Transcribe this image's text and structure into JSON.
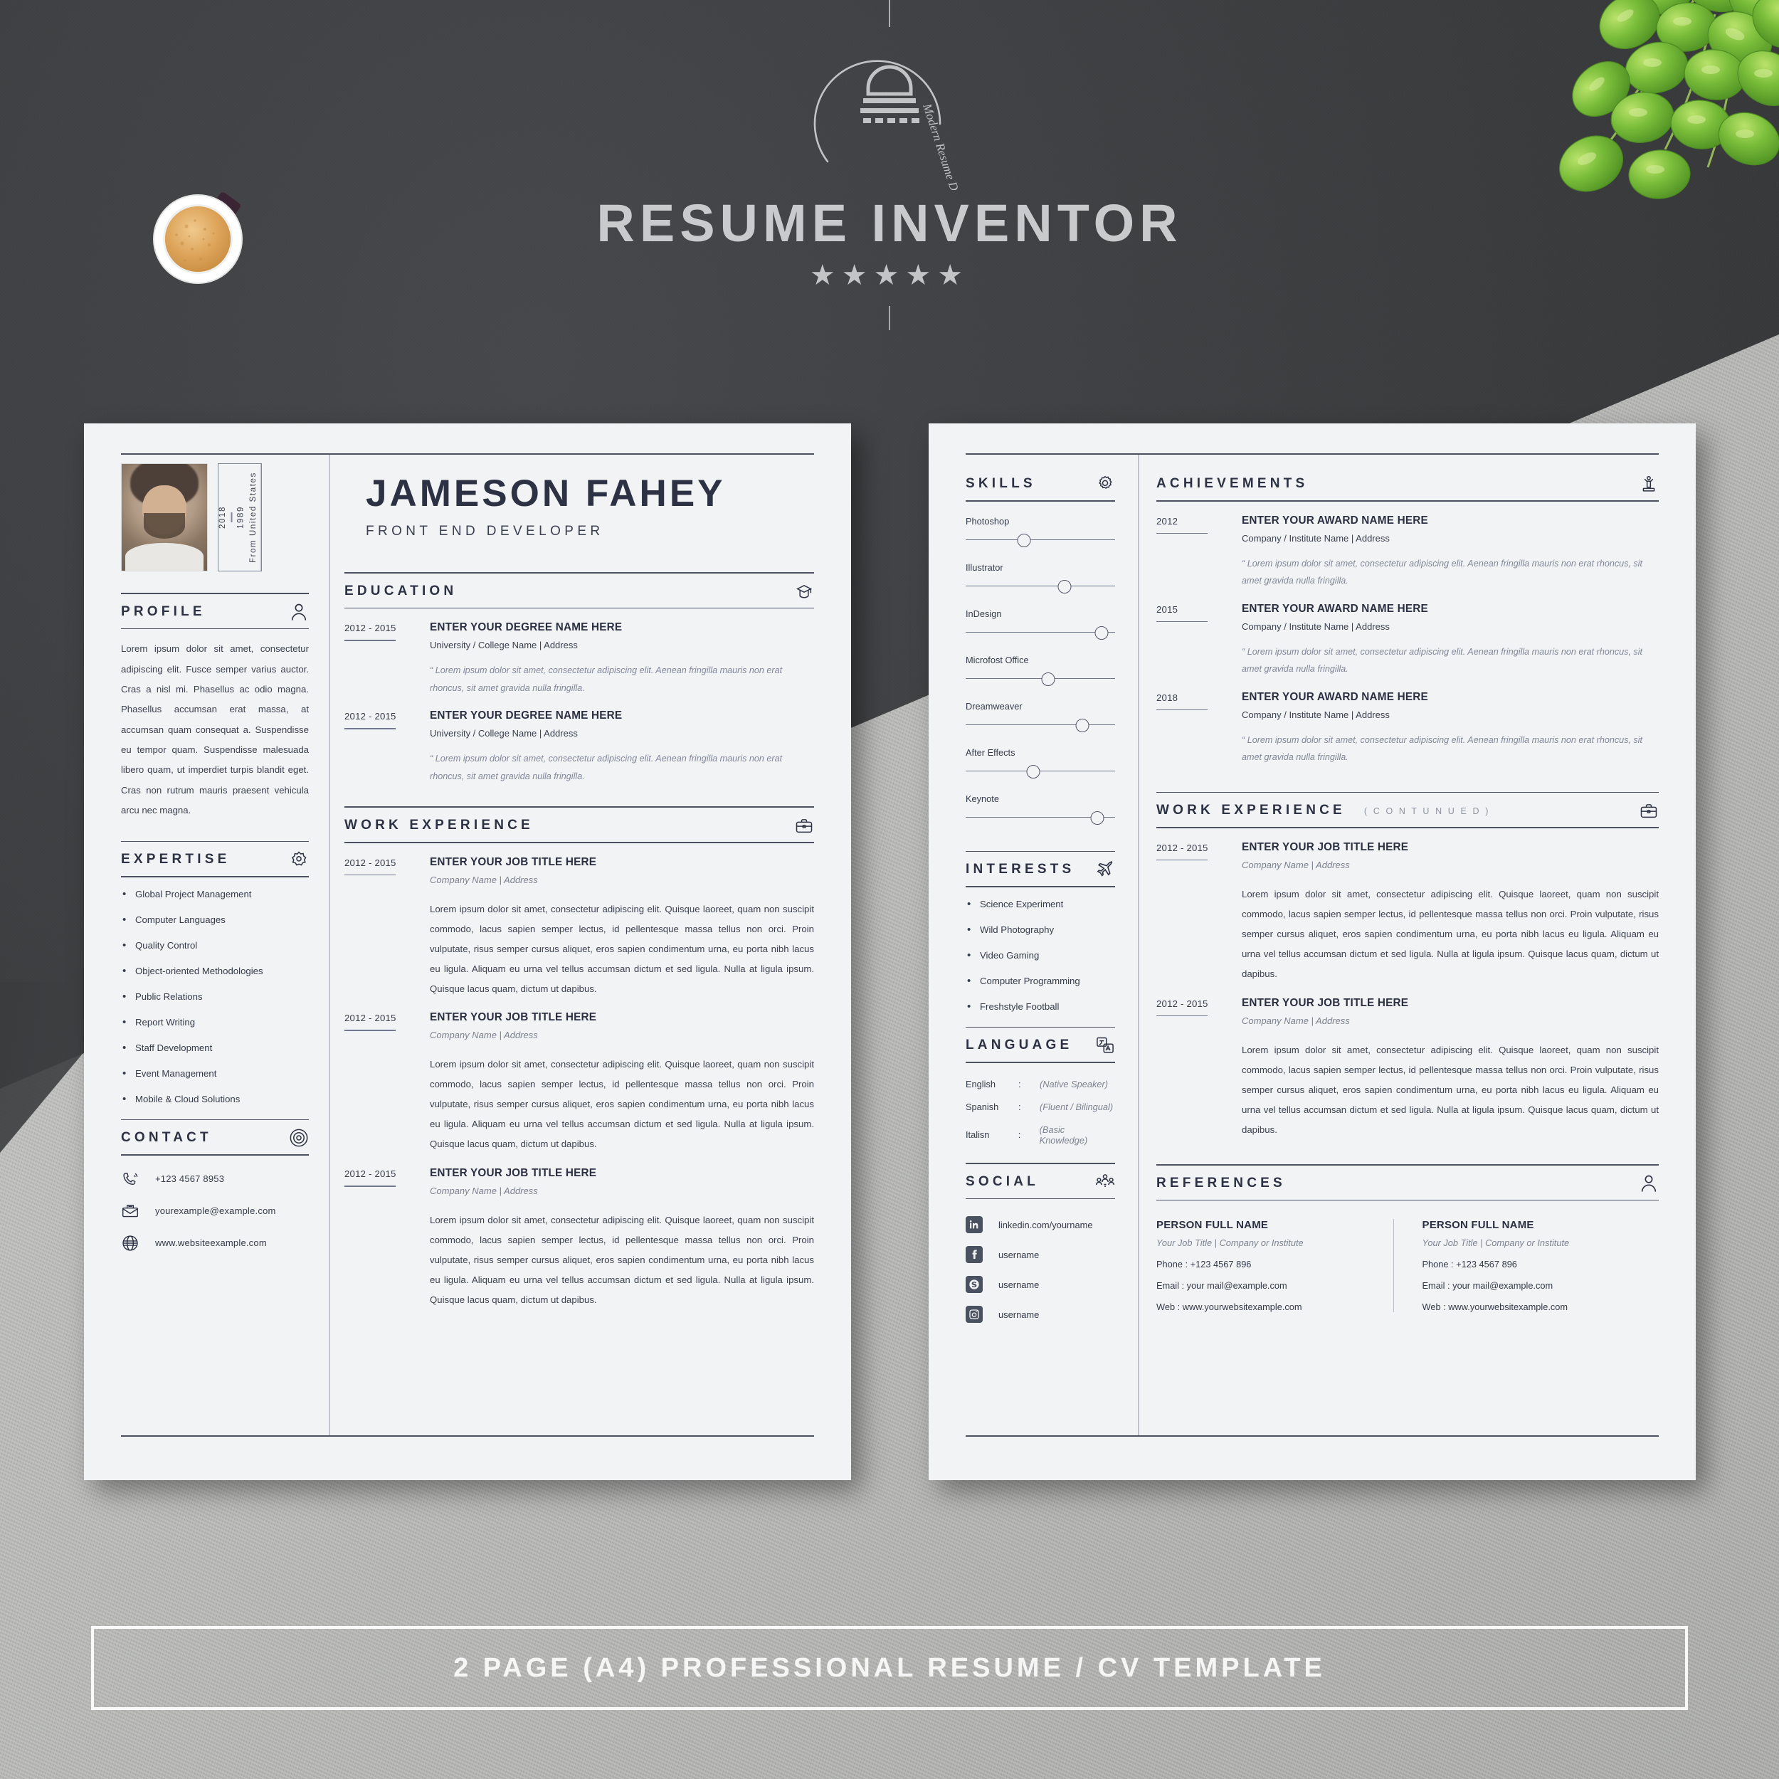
{
  "brand": {
    "title": "RESUME INVENTOR",
    "stars": "★★★★★",
    "logo_tagline": "Modern Resume Design",
    "logo_icon": "lamp-mark-icon"
  },
  "footer": {
    "text": "2 PAGE (A4) PROFESSIONAL RESUME / CV TEMPLATE"
  },
  "page1": {
    "header": {
      "name": "JAMESON FAHEY",
      "role": "FRONT END DEVELOPER",
      "year_from": "1989",
      "year_to": "2018",
      "origin": "From United States"
    },
    "profile": {
      "title": "PROFILE",
      "icon": "person-icon",
      "text": "Lorem ipsum dolor sit amet, consectetur adipiscing elit. Fusce semper varius auctor. Cras a nisl mi. Phasellus ac odio magna. Phasellus accumsan erat massa, at accumsan quam consequat a. Suspendisse eu tempor quam. Suspendisse malesuada libero quam, ut imperdiet turpis blandit eget. Cras non rutrum mauris praesent vehicula arcu nec magna."
    },
    "expertise": {
      "title": "EXPERTISE",
      "icon": "badge-star-icon",
      "items": [
        "Global Project Management",
        "Computer Languages",
        "Quality Control",
        "Object-oriented Methodologies",
        "Public Relations",
        "Report Writing",
        "Staff Development",
        "Event Management",
        "Mobile & Cloud Solutions"
      ]
    },
    "contact": {
      "title": "CONTACT",
      "icon": "at-sign-icon",
      "items": [
        {
          "icon": "phone-icon",
          "value": "+123 4567 8953"
        },
        {
          "icon": "envelope-icon",
          "value": "yourexample@example.com"
        },
        {
          "icon": "globe-icon",
          "value": "www.websiteexample.com"
        }
      ]
    },
    "education": {
      "title": "EDUCATION",
      "icon": "graduation-cap-icon",
      "entries": [
        {
          "date": "2012 - 2015",
          "title": "ENTER YOUR DEGREE NAME HERE",
          "org": "University / College Name | Address",
          "quote": "“ Lorem ipsum dolor sit amet, consectetur adipiscing elit. Aenean fringilla mauris non erat rhoncus, sit amet gravida nulla fringilla."
        },
        {
          "date": "2012 - 2015",
          "title": "ENTER YOUR DEGREE NAME HERE",
          "org": "University / College Name | Address",
          "quote": "“ Lorem ipsum dolor sit amet, consectetur adipiscing elit. Aenean fringilla mauris non erat rhoncus, sit amet gravida nulla fringilla."
        }
      ]
    },
    "work": {
      "title": "WORK EXPERIENCE",
      "icon": "briefcase-icon",
      "entries": [
        {
          "date": "2012 - 2015",
          "title": "ENTER YOUR JOB TITLE HERE",
          "org": "Company Name | Address",
          "para": "Lorem ipsum dolor sit amet, consectetur adipiscing elit. Quisque laoreet, quam non suscipit commodo, lacus sapien semper lectus, id pellentesque massa tellus non orci. Proin vulputate, risus semper cursus aliquet, eros sapien condimentum urna, eu porta nibh lacus eu ligula. Aliquam eu urna vel tellus accumsan dictum et sed ligula. Nulla at ligula ipsum. Quisque lacus quam, dictum ut dapibus."
        },
        {
          "date": "2012 - 2015",
          "title": "ENTER YOUR JOB TITLE HERE",
          "org": "Company Name | Address",
          "para": "Lorem ipsum dolor sit amet, consectetur adipiscing elit. Quisque laoreet, quam non suscipit commodo, lacus sapien semper lectus, id pellentesque massa tellus non orci. Proin vulputate, risus semper cursus aliquet, eros sapien condimentum urna, eu porta nibh lacus eu ligula. Aliquam eu urna vel tellus accumsan dictum et sed ligula. Nulla at ligula ipsum. Quisque lacus quam, dictum ut dapibus."
        },
        {
          "date": "2012 - 2015",
          "title": "ENTER YOUR JOB TITLE HERE",
          "org": "Company Name | Address",
          "para": "Lorem ipsum dolor sit amet, consectetur adipiscing elit. Quisque laoreet, quam non suscipit commodo, lacus sapien semper lectus, id pellentesque massa tellus non orci. Proin vulputate, risus semper cursus aliquet, eros sapien condimentum urna, eu porta nibh lacus eu ligula. Aliquam eu urna vel tellus accumsan dictum et sed ligula. Nulla at ligula ipsum. Quisque lacus quam, dictum ut dapibus."
        }
      ]
    }
  },
  "page2": {
    "skills": {
      "title": "SKILLS",
      "icon": "gear-icon",
      "items": [
        {
          "name": "Photoshop",
          "level": 39
        },
        {
          "name": "Illustrator",
          "level": 66
        },
        {
          "name": "InDesign",
          "level": 91
        },
        {
          "name": "Microfost Office",
          "level": 55
        },
        {
          "name": "Dreamweaver",
          "level": 78
        },
        {
          "name": "After Effects",
          "level": 45
        },
        {
          "name": "Keynote",
          "level": 88
        }
      ]
    },
    "interests": {
      "title": "INTERESTS",
      "icon": "airplane-icon",
      "items": [
        "Science Experiment",
        "Wild Photography",
        "Video Gaming",
        "Computer Programming",
        "Freshstyle Football"
      ]
    },
    "language": {
      "title": "LANGUAGE",
      "icon": "translate-icon",
      "items": [
        {
          "name": "English",
          "colon": ":",
          "level": "(Native Speaker)"
        },
        {
          "name": "Spanish",
          "colon": ":",
          "level": "(Fluent / Bilingual)"
        },
        {
          "name": "Italisn",
          "colon": ":",
          "level": "(Basic Knowledge)"
        }
      ]
    },
    "social": {
      "title": "SOCIAL",
      "icon": "people-group-icon",
      "items": [
        {
          "icon": "linkedin-icon",
          "value": "linkedin.com/yourname"
        },
        {
          "icon": "facebook-icon",
          "value": "username"
        },
        {
          "icon": "skype-icon",
          "value": "username"
        },
        {
          "icon": "instagram-icon",
          "value": "username"
        }
      ]
    },
    "achievements": {
      "title": "ACHIEVEMENTS",
      "icon": "podium-icon",
      "entries": [
        {
          "date": "2012",
          "title": "ENTER YOUR AWARD NAME HERE",
          "org": "Company / Institute Name | Address",
          "quote": "“ Lorem ipsum dolor sit amet, consectetur adipiscing elit. Aenean fringilla mauris non erat rhoncus, sit amet gravida nulla fringilla."
        },
        {
          "date": "2015",
          "title": "ENTER YOUR AWARD NAME HERE",
          "org": "Company / Institute Name | Address",
          "quote": "“ Lorem ipsum dolor sit amet, consectetur adipiscing elit. Aenean fringilla mauris non erat rhoncus, sit amet gravida nulla fringilla."
        },
        {
          "date": "2018",
          "title": "ENTER YOUR AWARD NAME HERE",
          "org": "Company / Institute Name | Address",
          "quote": "“ Lorem ipsum dolor sit amet, consectetur adipiscing elit. Aenean fringilla mauris non erat rhoncus, sit amet gravida nulla fringilla."
        }
      ]
    },
    "work": {
      "title": "WORK EXPERIENCE",
      "subtitle": "( C O N T U N U E D )",
      "icon": "briefcase-icon",
      "entries": [
        {
          "date": "2012 - 2015",
          "title": "ENTER YOUR JOB TITLE HERE",
          "org": "Company Name | Address",
          "para": "Lorem ipsum dolor sit amet, consectetur adipiscing elit. Quisque laoreet, quam non suscipit commodo, lacus sapien semper lectus, id pellentesque massa tellus non orci. Proin vulputate, risus semper cursus aliquet, eros sapien condimentum urna, eu porta nibh lacus eu ligula. Aliquam eu urna vel tellus accumsan dictum et sed ligula. Nulla at ligula ipsum. Quisque lacus quam, dictum ut dapibus."
        },
        {
          "date": "2012 - 2015",
          "title": "ENTER YOUR JOB TITLE HERE",
          "org": "Company Name | Address",
          "para": "Lorem ipsum dolor sit amet, consectetur adipiscing elit. Quisque laoreet, quam non suscipit commodo, lacus sapien semper lectus, id pellentesque massa tellus non orci. Proin vulputate, risus semper cursus aliquet, eros sapien condimentum urna, eu porta nibh lacus eu ligula. Aliquam eu urna vel tellus accumsan dictum et sed ligula. Nulla at ligula ipsum. Quisque lacus quam, dictum ut dapibus."
        }
      ]
    },
    "references": {
      "title": "REFERENCES",
      "icon": "person-icon",
      "items": [
        {
          "name": "PERSON FULL NAME",
          "role": "Your Job Title | Company or Institute",
          "phone": "Phone : +123 4567 896",
          "email": "Email : your mail@example.com",
          "web": "Web : www.yourwebsitexample.com"
        },
        {
          "name": "PERSON FULL NAME",
          "role": "Your Job Title | Company or Institute",
          "phone": "Phone : +123 4567 896",
          "email": "Email : your mail@example.com",
          "web": "Web : www.yourwebsitexample.com"
        }
      ]
    }
  },
  "colors": {
    "paper": "#f2f3f4",
    "ink": "#2c3244",
    "muted": "#7c8392",
    "rule": "#4b5160",
    "backdrop": "#3c3d3f"
  }
}
